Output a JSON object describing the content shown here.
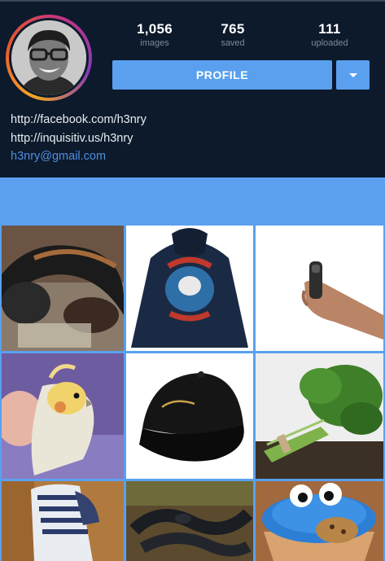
{
  "profile": {
    "stats": [
      {
        "value": "1,056",
        "label": "images"
      },
      {
        "value": "765",
        "label": "saved"
      },
      {
        "value": "111",
        "label": "uploaded"
      }
    ],
    "profile_button_label": "PROFILE",
    "links": {
      "facebook": "http://facebook.com/h3nry",
      "website": "http://inquisitiv.us/h3nry",
      "email": "h3nry@gmail.com"
    }
  },
  "colors": {
    "header_bg": "#0c1a2b",
    "accent": "#5aa0ef",
    "link": "#4f8fe0"
  },
  "grid": {
    "tiles": [
      {
        "name": "headphones"
      },
      {
        "name": "howard-bison-hoodie"
      },
      {
        "name": "hand-holding-device"
      },
      {
        "name": "cockatiel"
      },
      {
        "name": "black-cap"
      },
      {
        "name": "cilantro-bunch"
      },
      {
        "name": "sneakers"
      },
      {
        "name": "snake"
      },
      {
        "name": "cookie-monster-cupcake"
      }
    ]
  }
}
